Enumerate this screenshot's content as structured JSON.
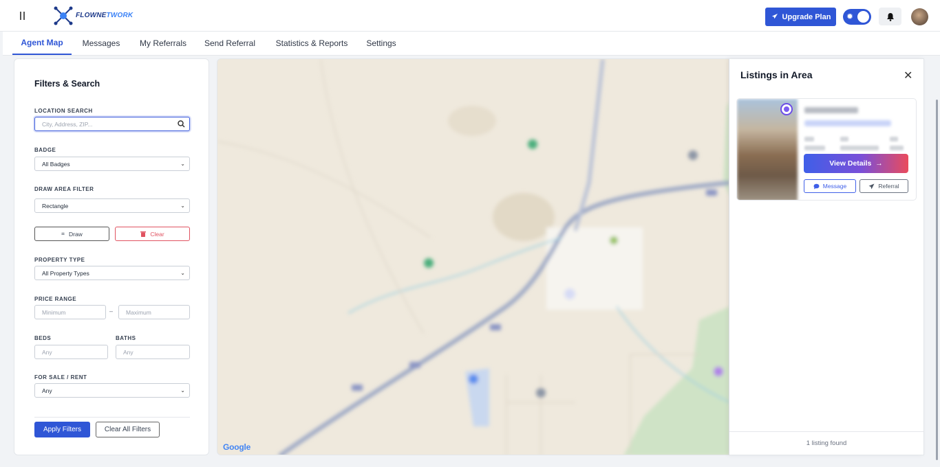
{
  "brand": {
    "name_part1": "FLOWNE",
    "name_part2": "TWORK"
  },
  "header": {
    "upgrade_label": "Upgrade Plan"
  },
  "tabs": [
    {
      "label": "Agent Map",
      "active": true
    },
    {
      "label": "Messages",
      "active": false
    },
    {
      "label": "My Referrals",
      "active": false
    },
    {
      "label": "Send Referral",
      "active": false
    },
    {
      "label": "Statistics & Reports",
      "active": false
    },
    {
      "label": "Settings",
      "active": false
    }
  ],
  "filters": {
    "title": "Filters & Search",
    "location": {
      "label": "LOCATION SEARCH",
      "placeholder": "City, Address, ZIP..."
    },
    "badge": {
      "label": "BADGE",
      "value": "All Badges"
    },
    "draw_area": {
      "label": "DRAW AREA FILTER",
      "value": "Rectangle",
      "draw_label": "Draw",
      "clear_label": "Clear"
    },
    "property_type": {
      "label": "PROPERTY TYPE",
      "value": "All Property Types"
    },
    "price": {
      "label": "PRICE RANGE",
      "min_placeholder": "Minimum",
      "max_placeholder": "Maximum",
      "separator": "–"
    },
    "beds": {
      "label": "BEDS",
      "placeholder": "Any"
    },
    "baths": {
      "label": "BATHS",
      "placeholder": "Any"
    },
    "sale_rent": {
      "label": "FOR SALE / RENT",
      "value": "Any"
    },
    "apply_label": "Apply Filters",
    "clear_all_label": "Clear All Filters"
  },
  "map": {
    "attribution": "Google"
  },
  "listings": {
    "title": "Listings in Area",
    "card": {
      "view_details_label": "View Details",
      "message_label": "Message",
      "referral_label": "Referral"
    },
    "count_text": "1 listing found"
  },
  "colors": {
    "accent": "#2f56d6",
    "danger": "#e05260",
    "gradient_start": "#3f5fe8",
    "gradient_end": "#ea4b5c"
  }
}
